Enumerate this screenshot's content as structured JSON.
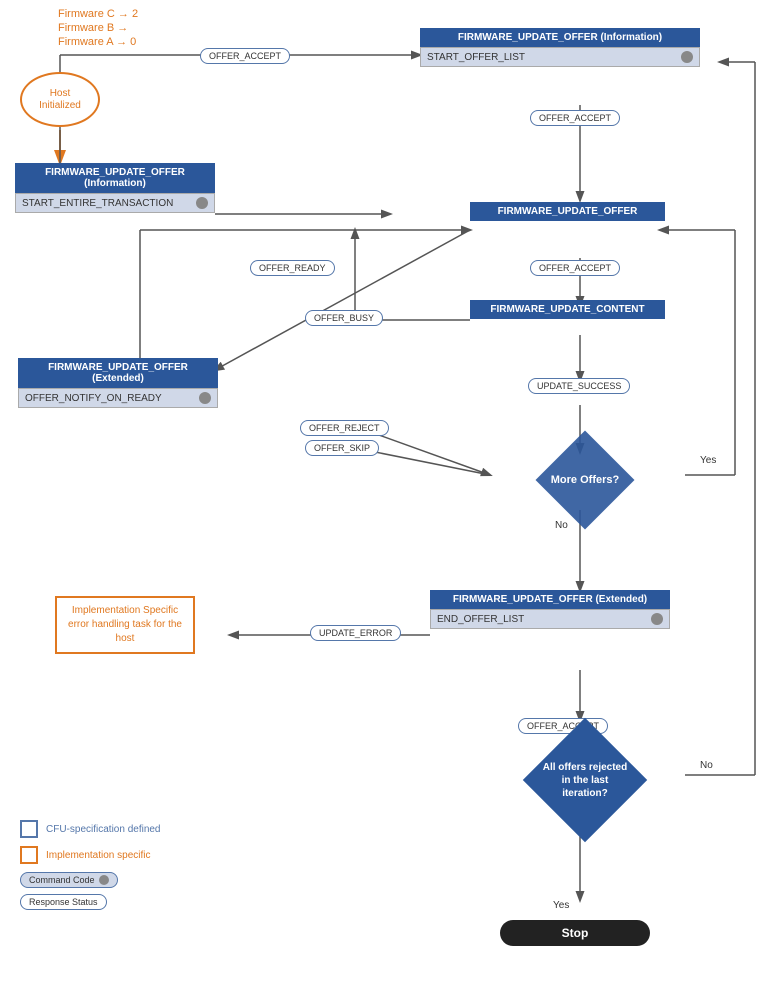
{
  "firmware_labels": [
    {
      "text": "Firmware C → 2"
    },
    {
      "text": "Firmware B →"
    },
    {
      "text": "Firmware A → 0"
    }
  ],
  "host_initialized": {
    "label": "Host\nInitialized"
  },
  "top_right_block": {
    "header": "FIRMWARE_UPDATE_OFFER (Information)",
    "sub": "START_OFFER_LIST"
  },
  "left_block": {
    "header": "FIRMWARE_UPDATE_OFFER (Information)",
    "sub": "START_ENTIRE_TRANSACTION"
  },
  "middle_offer_block": {
    "header": "FIRMWARE_UPDATE_OFFER"
  },
  "content_block": {
    "header": "FIRMWARE_UPDATE_CONTENT"
  },
  "notify_block": {
    "header": "FIRMWARE_UPDATE_OFFER (Extended)",
    "sub": "OFFER_NOTIFY_ON_READY"
  },
  "end_offer_block": {
    "header": "FIRMWARE_UPDATE_OFFER (Extended)",
    "sub": "END_OFFER_LIST"
  },
  "more_offers_diamond": {
    "text": "More Offers?"
  },
  "all_rejected_diamond": {
    "text": "All offers rejected\nin the last\niteration?"
  },
  "oval_labels": {
    "offer_accept_1": "OFFER_ACCEPT",
    "offer_accept_2": "OFFER_ACCEPT",
    "offer_accept_3": "OFFER_ACCEPT",
    "offer_accept_4": "OFFER_ACCEPT",
    "offer_ready": "OFFER_READY",
    "offer_busy": "OFFER_BUSY",
    "offer_reject": "OFFER_REJECT",
    "offer_skip": "OFFER_SKIP",
    "update_success": "UPDATE_SUCCESS",
    "update_error": "UPDATE_ERROR"
  },
  "yes_label": "Yes",
  "no_label": "No",
  "no_label2": "No",
  "yes_label2": "Yes",
  "error_box": {
    "text": "Implementation Specific error handling task for the host"
  },
  "stop_label": "Stop",
  "legend": {
    "cfu_label": "CFU-specification defined",
    "impl_label": "Implementation specific",
    "command_code": "Command Code",
    "response_status": "Response Status"
  }
}
